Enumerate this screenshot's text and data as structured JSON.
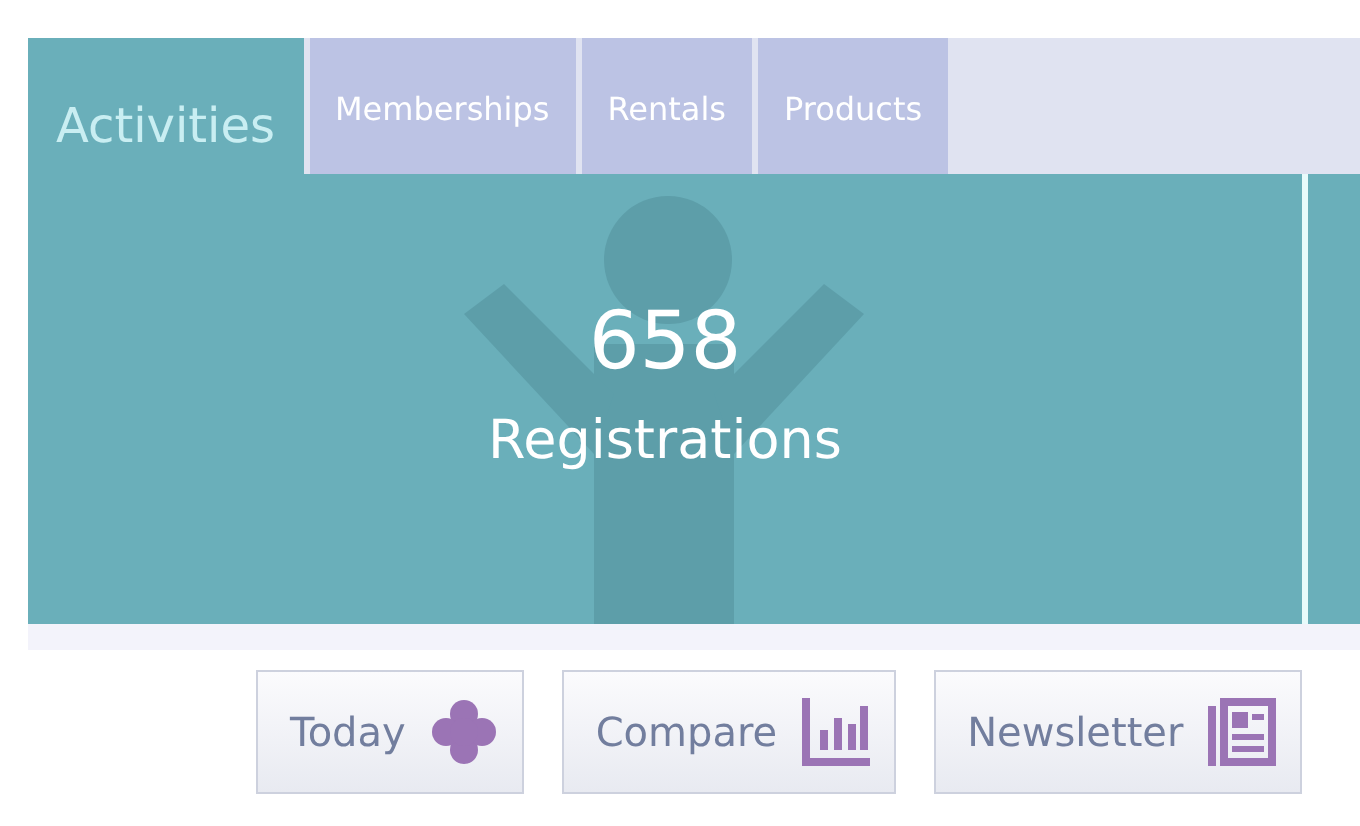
{
  "tabs": [
    {
      "label": "Activities",
      "selected": true
    },
    {
      "label": "Memberships",
      "selected": false
    },
    {
      "label": "Rentals",
      "selected": false
    },
    {
      "label": "Products",
      "selected": false
    }
  ],
  "stat": {
    "value": "658",
    "label": "Registrations"
  },
  "buttons": [
    {
      "label": "Today",
      "kind": "clover"
    },
    {
      "label": "Compare",
      "kind": "chart"
    },
    {
      "label": "Newsletter",
      "kind": "news"
    }
  ]
}
